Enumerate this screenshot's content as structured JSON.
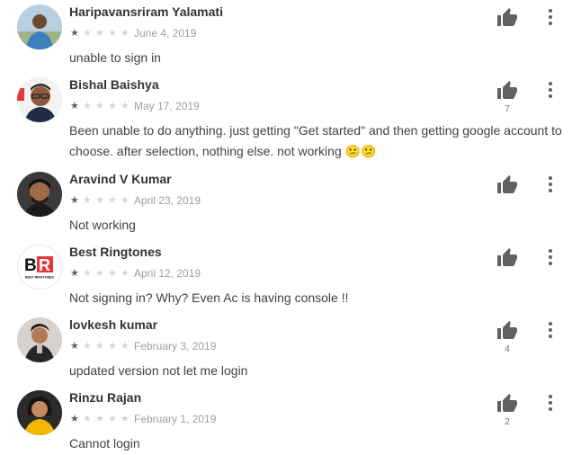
{
  "reviews": [
    {
      "author": "Haripavansriram Yalamati",
      "rating": 1,
      "max_rating": 5,
      "date": "June 4, 2019",
      "text": "unable to sign in",
      "helpful_count": "",
      "avatar": "photo-man-outdoors"
    },
    {
      "author": "Bishal Baishya",
      "rating": 1,
      "max_rating": 5,
      "date": "May 17, 2019",
      "text": "Been unable to do anything. just getting \"Get started\" and then getting google account to choose. after selection, nothing else. not working 😕😕",
      "helpful_count": "7",
      "avatar": "photo-man-glasses"
    },
    {
      "author": "Aravind V Kumar",
      "rating": 1,
      "max_rating": 5,
      "date": "April 23, 2019",
      "text": "Not working",
      "helpful_count": "",
      "avatar": "photo-man-bearded"
    },
    {
      "author": "Best Ringtones",
      "rating": 1,
      "max_rating": 5,
      "date": "April 12, 2019",
      "text": "Not signing in? Why? Even Ac is having console !!",
      "helpful_count": "",
      "avatar": "logo-br",
      "avatar_text": "BR",
      "avatar_subtext": "BEST RINGTONES"
    },
    {
      "author": "lovkesh kumar",
      "rating": 1,
      "max_rating": 5,
      "date": "February 3, 2019",
      "text": "updated version not let me login",
      "helpful_count": "4",
      "avatar": "photo-man-dark"
    },
    {
      "author": "Rinzu Rajan",
      "rating": 1,
      "max_rating": 5,
      "date": "February 1, 2019",
      "text": "Cannot login",
      "helpful_count": "2",
      "avatar": "photo-woman-yellow"
    }
  ],
  "icons": {
    "helpful": "thumbs-up-icon",
    "more": "more-vert-icon",
    "star": "star-icon"
  },
  "colors": {
    "star_filled": "#616161",
    "star_empty": "#d6d6d6",
    "icon": "#616161",
    "logo_red": "#e53935"
  }
}
